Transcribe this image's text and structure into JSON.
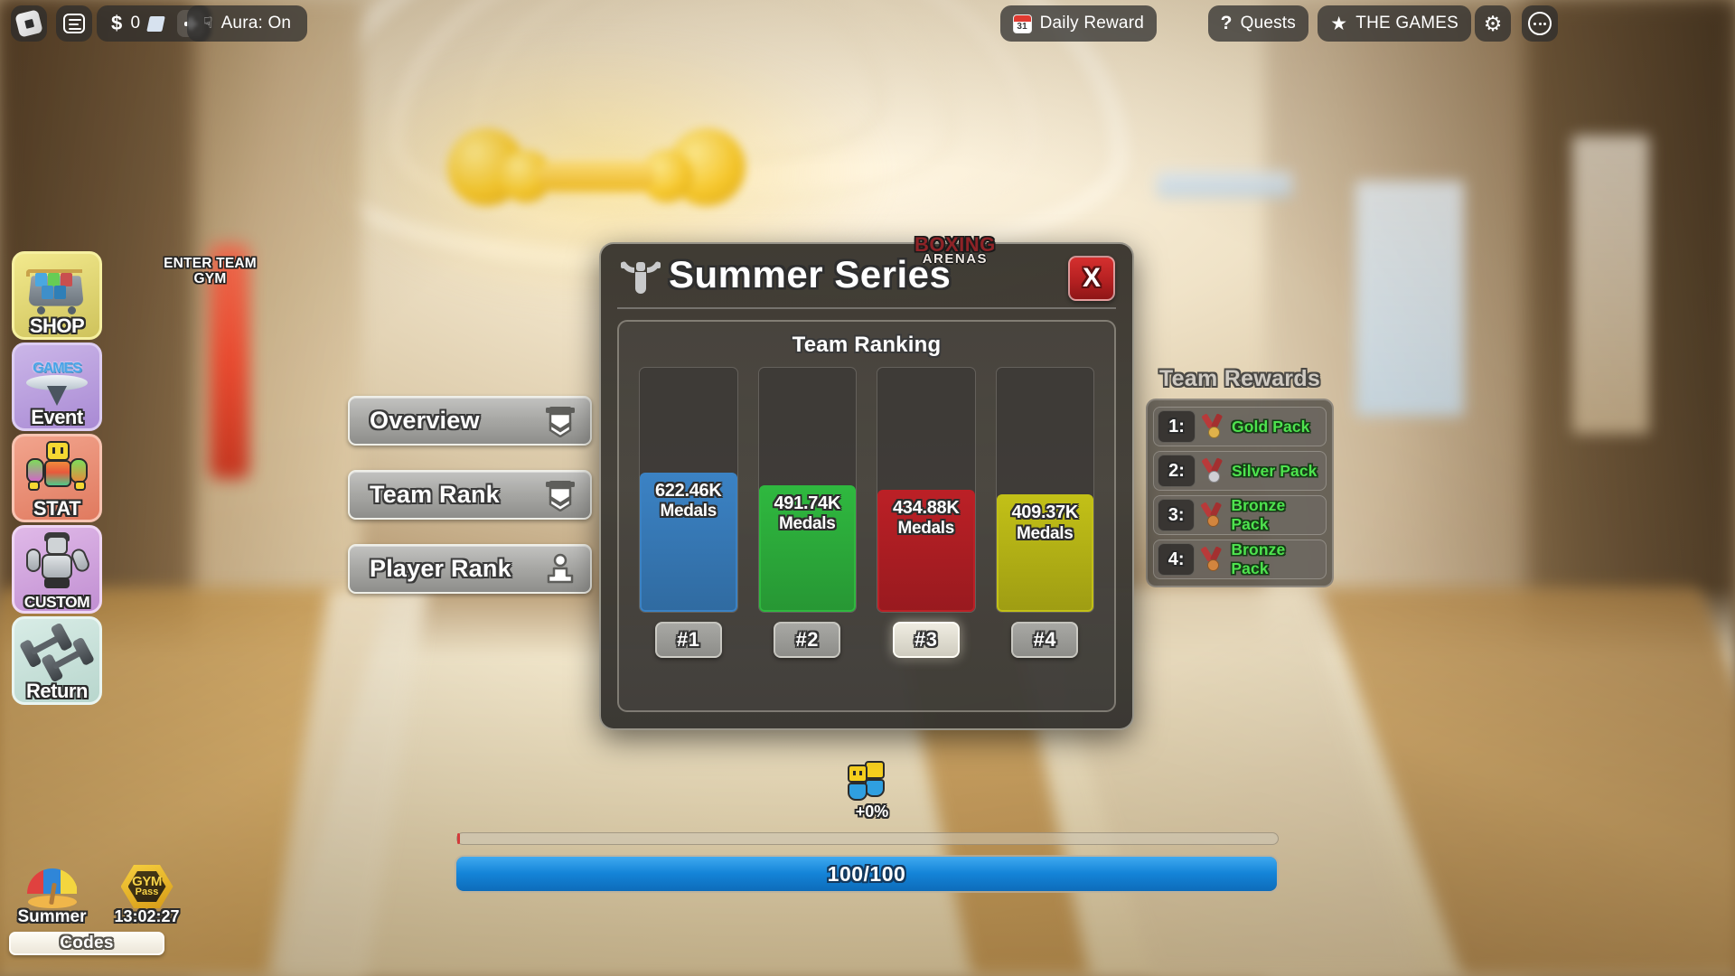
{
  "topbar": {
    "roblox_logo": "roblox-logo",
    "menu": "menu-icon",
    "currency": {
      "symbol": "$",
      "amount": "0"
    },
    "aura": {
      "label": "Aura: On"
    },
    "daily_reward": {
      "label": "Daily Reward",
      "icon": "calendar-icon",
      "day": "31"
    },
    "quests": {
      "label": "Quests",
      "icon": "question-icon"
    },
    "the_games": {
      "label": "THE GAMES",
      "icon": "star-icon"
    },
    "settings": "gear-icon",
    "more": "more-icon"
  },
  "sidebar": {
    "items": [
      {
        "label": "SHOP",
        "icon": "shopping-cart-icon"
      },
      {
        "label": "Event",
        "icon": "games-event-icon"
      },
      {
        "label": "STAT",
        "icon": "muscle-character-icon"
      },
      {
        "label": "CUSTOM",
        "icon": "customize-character-icon"
      },
      {
        "label": "Return",
        "icon": "dumbbell-icon"
      }
    ]
  },
  "world": {
    "enter_team_gym_line1": "ENTER TEAM",
    "enter_team_gym_line2": "GYM"
  },
  "nav": {
    "buttons": [
      {
        "label": "Overview",
        "icon": "banner-icon"
      },
      {
        "label": "Team Rank",
        "icon": "banner-icon"
      },
      {
        "label": "Player Rank",
        "icon": "person-icon"
      }
    ]
  },
  "modal": {
    "title": "Summer Series",
    "icon": "muscle-flex-icon",
    "close_label": "X",
    "section_title": "Team Ranking"
  },
  "watermark": {
    "line1": "BOXING",
    "line2": "ARENAS"
  },
  "rewards": {
    "title": "Team Rewards",
    "rows": [
      {
        "place": "1:",
        "pack": "Gold Pack",
        "medal_color": "#e0b24a"
      },
      {
        "place": "2:",
        "pack": "Silver Pack",
        "medal_color": "#cfcfd4"
      },
      {
        "place": "3:",
        "pack": "Bronze Pack",
        "medal_color": "#d2853e"
      },
      {
        "place": "4:",
        "pack": "Bronze Pack",
        "medal_color": "#d2853e"
      }
    ]
  },
  "bonus": {
    "label": "+0%",
    "icon": "teammates-icon"
  },
  "progress": {
    "xp_label": "100/100",
    "xp_percent": 100,
    "thin_percent": 0
  },
  "bottom_left": {
    "summer": {
      "label": "Summer",
      "icon": "beach-umbrella-icon"
    },
    "gym_pass": {
      "label": "13:02:27",
      "icon": "gym-pass-icon",
      "badge_line1": "GYM",
      "badge_line2": "Pass"
    },
    "codes": {
      "label": "Codes"
    }
  },
  "chart_data": {
    "type": "bar",
    "title": "Team Ranking",
    "xlabel": "",
    "ylabel": "Medals",
    "categories": [
      "#1",
      "#2",
      "#3",
      "#4"
    ],
    "values": [
      622460,
      491740,
      434880,
      409370
    ],
    "value_labels": [
      "622.46K",
      "491.74K",
      "434.88K",
      "409.37K"
    ],
    "unit_label": "Medals",
    "selected_category": "#3",
    "series_colors": [
      "#3b82c4",
      "#2fb83f",
      "#bb2026",
      "#c2c017"
    ],
    "bar_fill_percent": [
      57,
      52,
      50,
      48
    ],
    "ylim": [
      0,
      1100000
    ],
    "grid": false,
    "legend": "none"
  }
}
